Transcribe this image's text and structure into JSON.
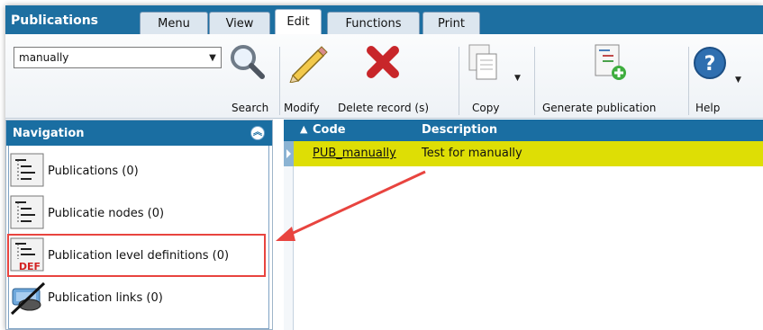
{
  "app": {
    "title": "Publications"
  },
  "tabs": [
    {
      "label": "Menu"
    },
    {
      "label": "View"
    },
    {
      "label": "Edit",
      "active": true
    },
    {
      "label": "Functions"
    },
    {
      "label": "Print"
    }
  ],
  "ribbon": {
    "search_combo_value": "manually",
    "search_label": "Search",
    "modify_label": "Modify",
    "delete_label": "Delete record (s)",
    "copy_label": "Copy",
    "generate_label": "Generate publication",
    "help_label": "Help"
  },
  "navigation": {
    "title": "Navigation",
    "items": [
      {
        "label": "Publications (0)",
        "icon": "tree-icon"
      },
      {
        "label": "Publicatie nodes (0)",
        "icon": "tree-icon"
      },
      {
        "label": "Publication level definitions (0)",
        "icon": "tree-def-icon",
        "highlighted": true
      },
      {
        "label": "Publication links (0)",
        "icon": "link-icon"
      }
    ]
  },
  "grid": {
    "columns": [
      "Code",
      "Description"
    ],
    "sort_indicator": "▲",
    "rows": [
      {
        "code": "PUB_manually",
        "description": "Test for manually",
        "selected": true
      }
    ]
  },
  "colors": {
    "header_blue": "#1a6ea2",
    "selected_row": "#dede05",
    "annotation_red": "#e8443f"
  }
}
